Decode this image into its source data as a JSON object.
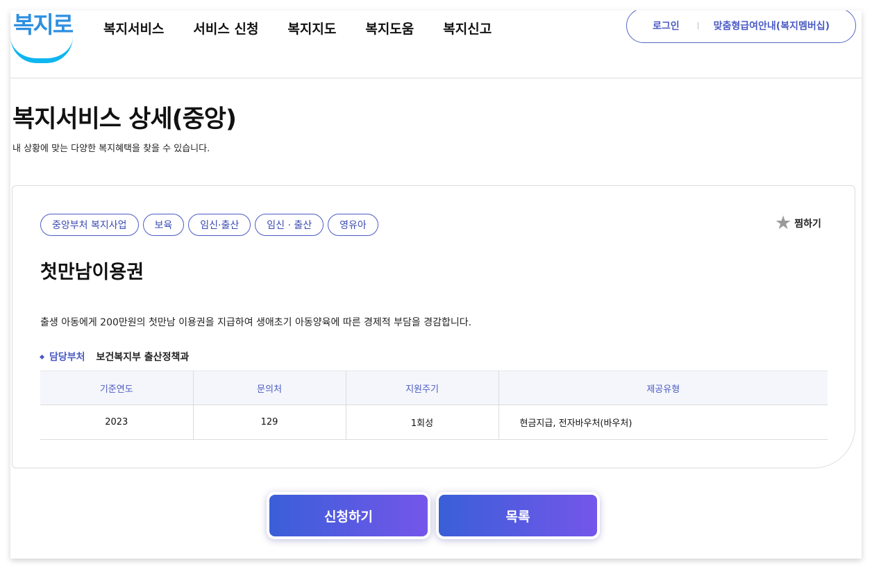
{
  "header": {
    "logo_text": "복지로",
    "nav": [
      "복지서비스",
      "서비스 신청",
      "복지지도",
      "복지도움",
      "복지신고"
    ],
    "login": "로그인",
    "membership": "맞춤형급여안내(복지멤버십)"
  },
  "page": {
    "title": "복지서비스 상세(중앙)",
    "description": "내 상황에 맞는 다양한 복지혜택을 찾을 수 있습니다."
  },
  "service": {
    "tags": [
      "중앙부처 복지사업",
      "보육",
      "임신·출산",
      "임신 · 출산",
      "영유아"
    ],
    "favorite_label": "찜하기",
    "name": "첫만남이용권",
    "summary": "출생 아동에게 200만원의 첫만남 이용권을 지급하여 생애초기 아동양육에 따른 경제적 부담을 경감합니다.",
    "department_label": "담당부처",
    "department": "보건복지부 출산정책과",
    "table": {
      "headers": [
        "기준연도",
        "문의처",
        "지원주기",
        "제공유형"
      ],
      "row": [
        "2023",
        "129",
        "1회성",
        "현금지급, 전자바우처(바우처)"
      ]
    }
  },
  "actions": {
    "apply": "신청하기",
    "list": "목록"
  },
  "colors": {
    "accent": "#4a5bc4",
    "button_start": "#3a5fd8",
    "button_end": "#7456ea",
    "logo": "#2f8fe0"
  }
}
